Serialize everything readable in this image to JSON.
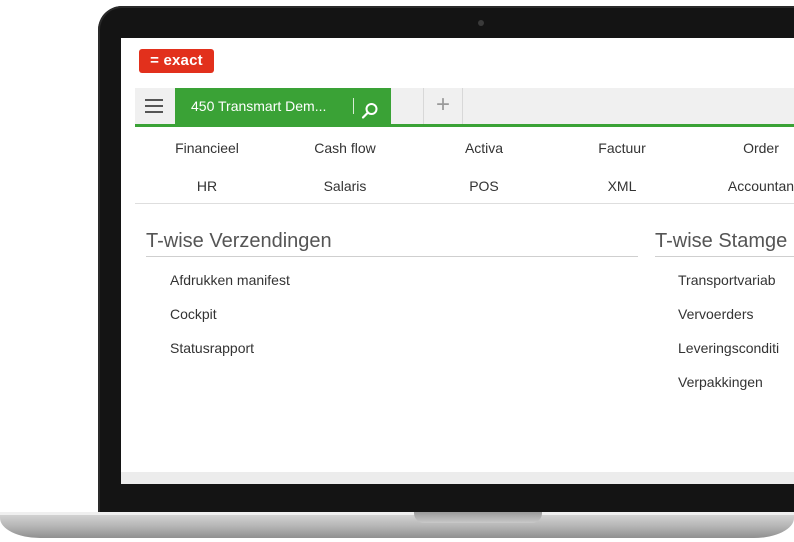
{
  "app": {
    "logo_text": "= exact",
    "brand_color": "#e2301c",
    "accent_color": "#3aa236"
  },
  "tabbar": {
    "menu_icon": "hamburger-icon",
    "company_label": "450  Transmart Dem...",
    "search_icon": "search-icon",
    "add_label": "+"
  },
  "menu": {
    "row1": [
      "Financieel",
      "Cash flow",
      "Activa",
      "Factuur",
      "Order"
    ],
    "row2": [
      "HR",
      "Salaris",
      "POS",
      "XML",
      "Accountan"
    ]
  },
  "sections": {
    "left": {
      "title": "T-wise Verzendingen",
      "links": [
        "Afdrukken manifest",
        "Cockpit",
        "Statusrapport"
      ]
    },
    "right": {
      "title": "T-wise Stamge",
      "links": [
        "Transportvariab",
        "Vervoerders",
        "Leveringsconditi",
        "Verpakkingen"
      ]
    }
  }
}
